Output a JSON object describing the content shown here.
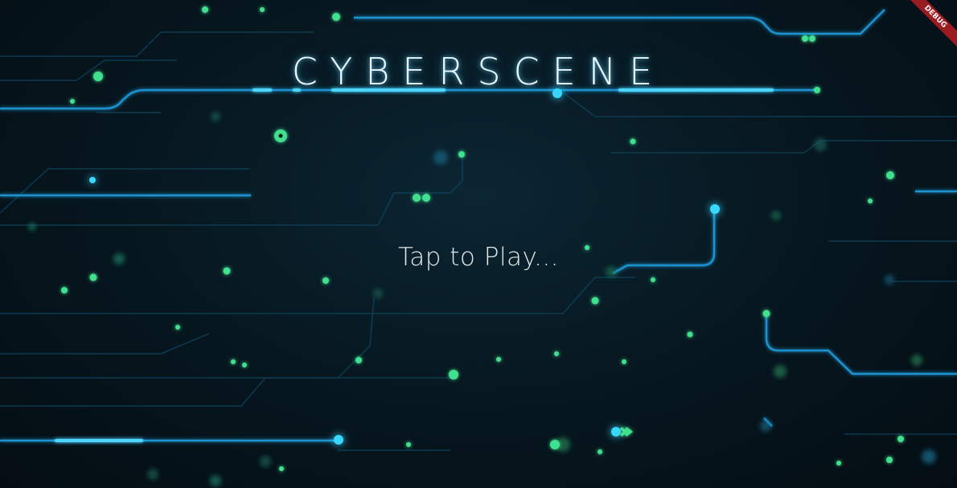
{
  "game": {
    "title": "CYBERSCENE",
    "prompt": "Tap to Play...",
    "debug_banner": "DEBUG"
  },
  "colors": {
    "background": "#06121a",
    "circuit_blue": "#1da0d8",
    "glow_cyan": "#38d8ff",
    "dot_green": "#3fe08f",
    "ribbon": "#9b1c20"
  }
}
